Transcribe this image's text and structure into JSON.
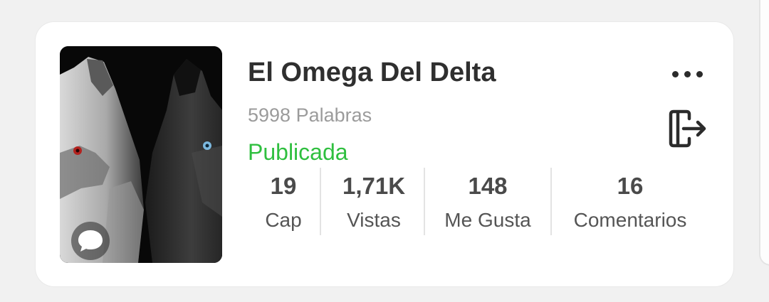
{
  "story": {
    "title": "El Omega Del Delta",
    "words": "5998 Palabras",
    "status": "Publicada",
    "cover_icon": "comment-icon",
    "status_color": "#2fbf3f"
  },
  "actions": {
    "more_icon": "more-horizontal-icon",
    "exit_icon": "exit-icon"
  },
  "stats": [
    {
      "value": "19",
      "label": "Cap"
    },
    {
      "value": "1,71K",
      "label": "Vistas"
    },
    {
      "value": "148",
      "label": "Me Gusta"
    },
    {
      "value": "16",
      "label": "Comentarios"
    }
  ]
}
